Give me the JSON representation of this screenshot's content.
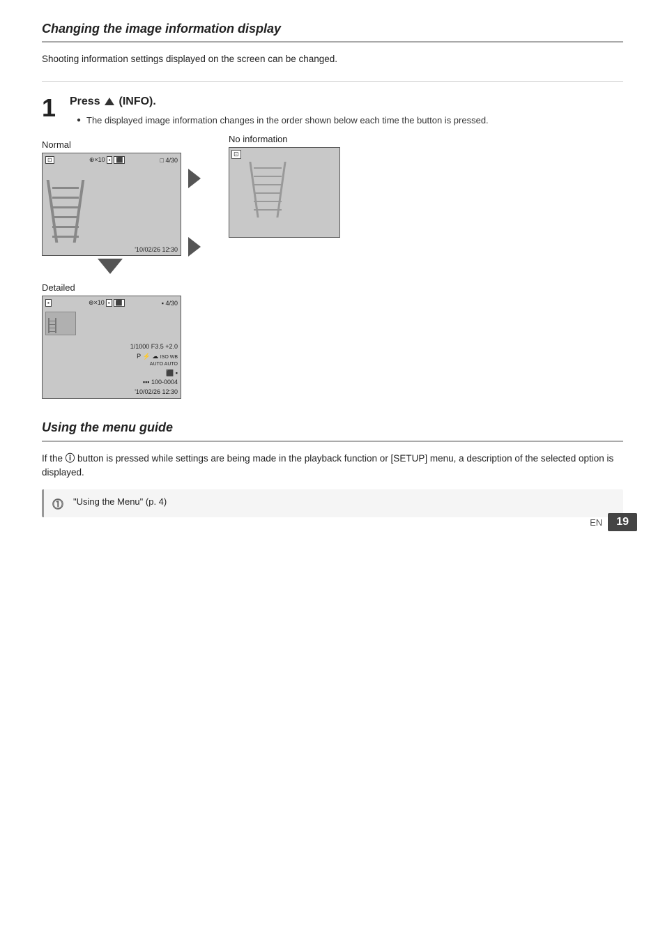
{
  "page": {
    "number": "19",
    "en_label": "EN"
  },
  "section1": {
    "heading": "Changing the image information display",
    "intro": "Shooting information settings displayed on the screen can be changed.",
    "step_number": "1",
    "step_title": "Press",
    "step_title_button": "(INFO).",
    "bullet": "The displayed image information changes in the order shown below each time the button is pressed.",
    "label_normal": "Normal",
    "label_detailed": "Detailed",
    "label_no_info": "No information",
    "normal_top_left": "⊡",
    "normal_top_center": "⊕×10 ⬛⬜",
    "normal_top_right": "□ 4/30",
    "normal_bottom": "'10/02/26  12:30",
    "detailed_top_left": "▪",
    "detailed_top_center": "⊕×10 ⬛⬜",
    "detailed_top_right": "▪ 4/30",
    "detailed_line1": "1/1000  F3.5  +2.0",
    "detailed_line2": "P  ⚡  ☁  ISO WB",
    "detailed_line3": "AUTO AUTO",
    "detailed_line4": "⬛ ▪",
    "detailed_line5": "▪▪▪ 100-0004",
    "detailed_line6": "'10/02/26  12:30",
    "no_info_icon": "⊡"
  },
  "section2": {
    "heading": "Using the menu guide",
    "body": "If the ⓘ button is pressed while settings are being made in the playback function or [SETUP] menu, a description of the selected option is displayed.",
    "note_text": "\"Using the Menu\" (p. 4)"
  }
}
